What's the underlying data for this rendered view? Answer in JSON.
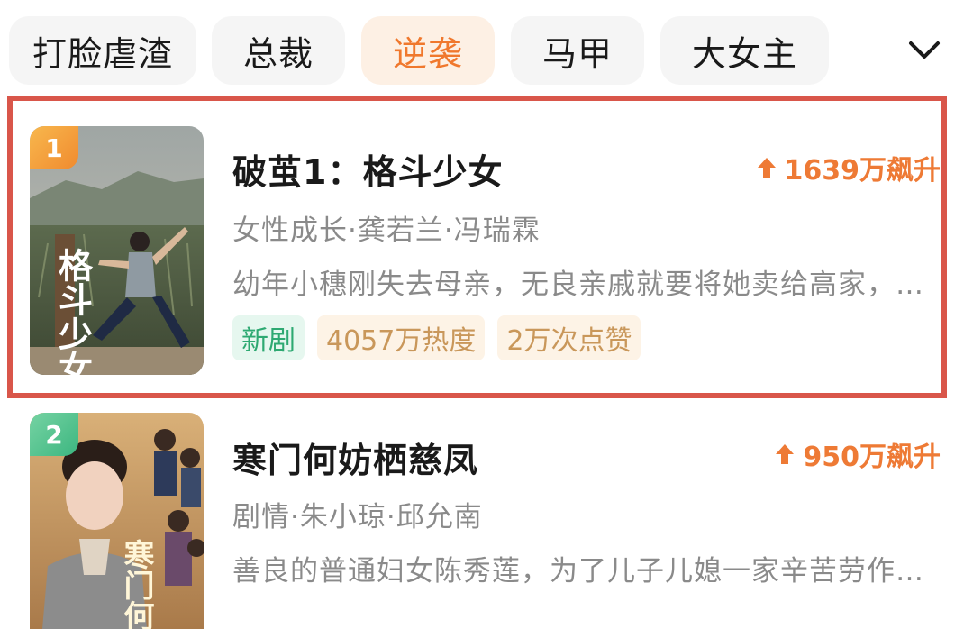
{
  "tabs": [
    {
      "label": "打脸虐渣",
      "active": false
    },
    {
      "label": "总裁",
      "active": false
    },
    {
      "label": "逆袭",
      "active": true
    },
    {
      "label": "马甲",
      "active": false
    },
    {
      "label": "大女主",
      "active": false
    }
  ],
  "colors": {
    "accent": "#f0782d",
    "highlight_frame": "#d9564a",
    "tag_green": "#2ea972",
    "tag_gold": "#c9975a"
  },
  "items": [
    {
      "rank": "1",
      "title": "破茧1：格斗少女",
      "trend": "1639万飙升",
      "tags": "女性成长·龚若兰·冯瑞霖",
      "description": "幼年小穗刚失去母亲，无良亲戚就要将她卖给高家，…",
      "badges": [
        "新剧",
        "4057万热度",
        "2万次点赞"
      ],
      "poster_text": "格斗少女"
    },
    {
      "rank": "2",
      "title": "寒门何妨栖慈凤",
      "trend": "950万飙升",
      "tags": "剧情·朱小琼·邱允南",
      "description": "善良的普通妇女陈秀莲，为了儿子儿媳一家辛苦劳作…",
      "poster_text": "寒门何"
    }
  ]
}
